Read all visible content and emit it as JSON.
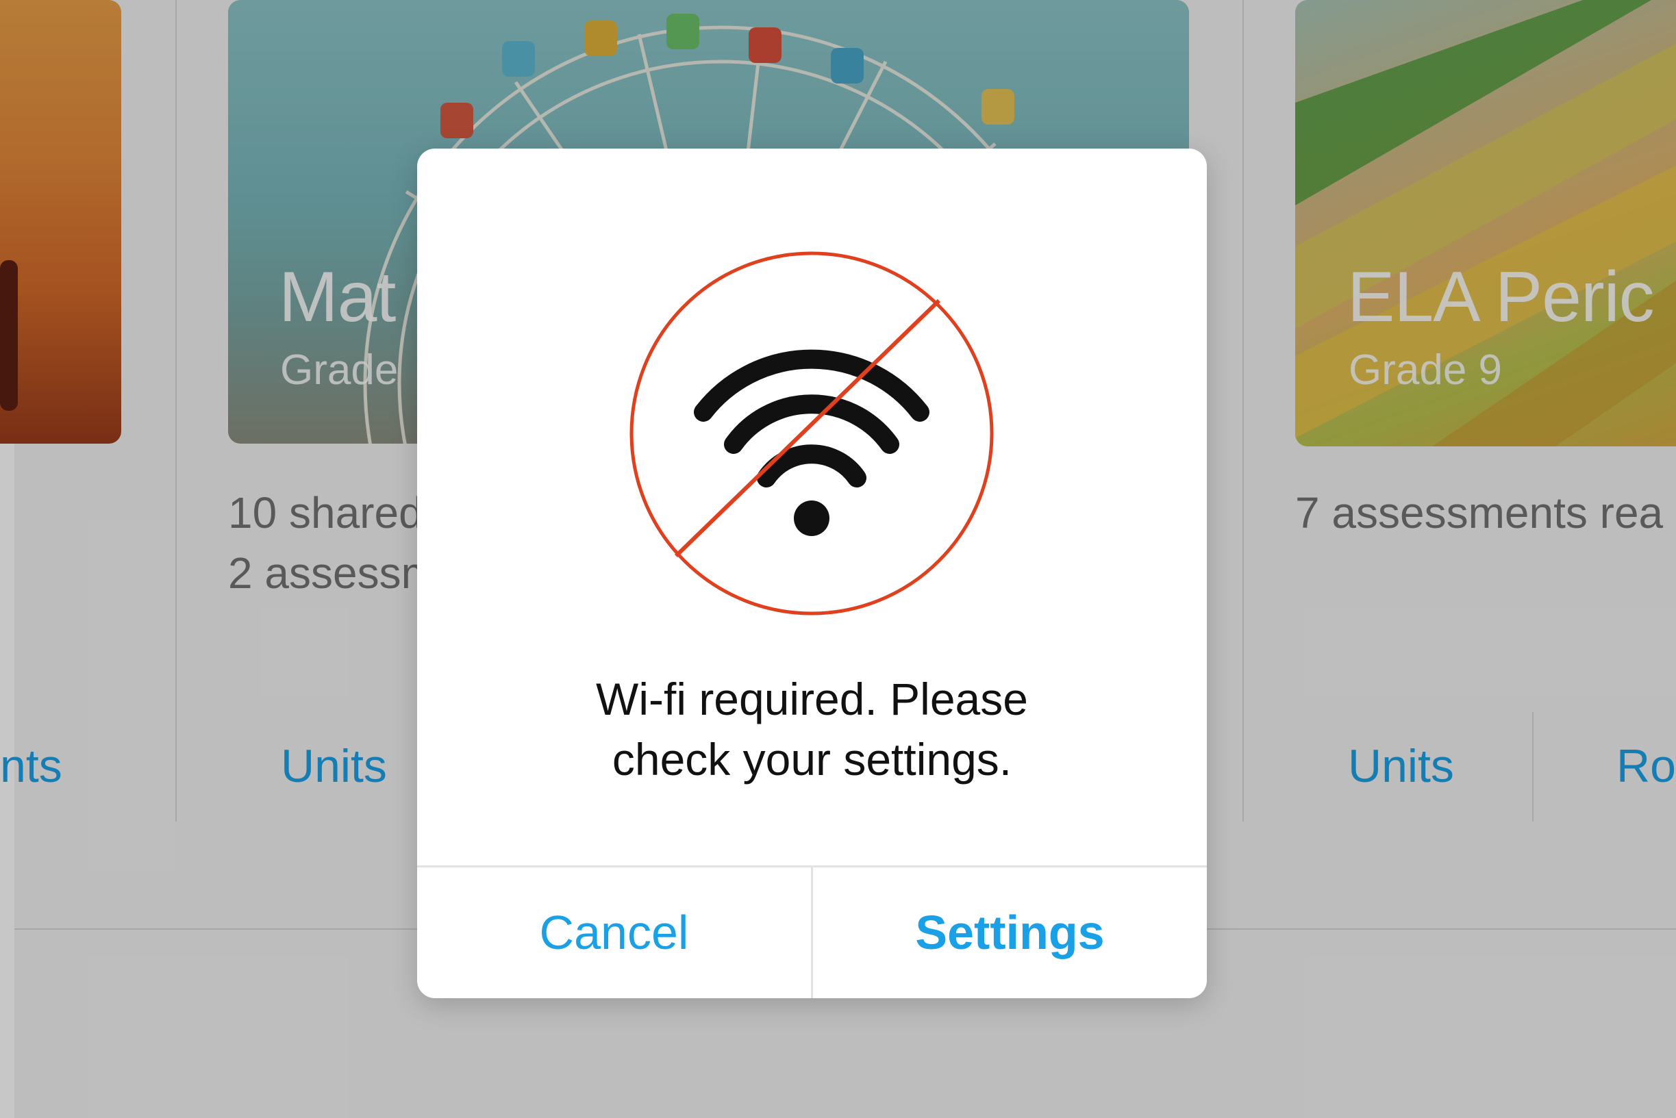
{
  "background": {
    "cards": [
      {
        "title": "",
        "subtitle": "",
        "info_lines": [],
        "link_label": "nts"
      },
      {
        "title": "Mat",
        "subtitle": "Grade",
        "info_lines": [
          "10 shared",
          "2 assessm"
        ],
        "link_label": "Units"
      },
      {
        "title": "ELA Peric",
        "subtitle": "Grade 9",
        "info_lines": [
          "7 assessments rea"
        ],
        "link_label": "Units",
        "link_label_2": "Ro"
      }
    ]
  },
  "dialog": {
    "icon": "wifi-off-icon",
    "message_line_1": "Wi-fi required. Please",
    "message_line_2": "check your settings.",
    "cancel_label": "Cancel",
    "settings_label": "Settings"
  },
  "colors": {
    "accent": "#1aa0e6",
    "prohibition": "#e0401e"
  }
}
